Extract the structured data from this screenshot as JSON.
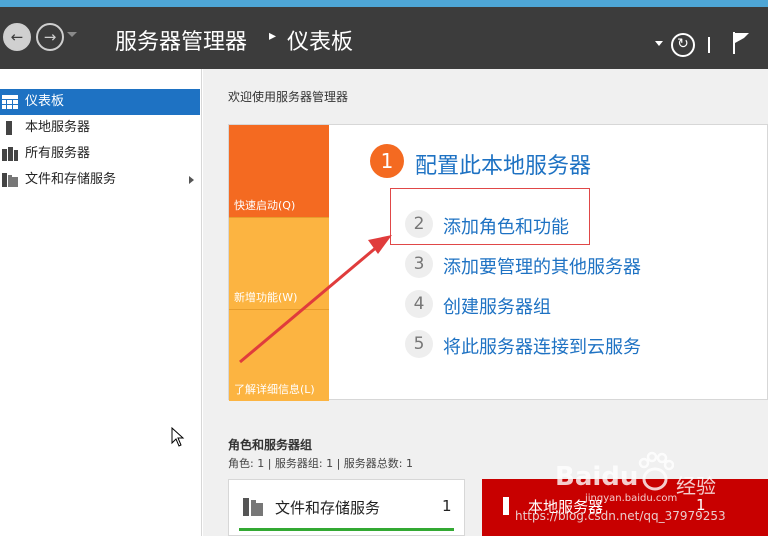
{
  "header": {
    "title": "服务器管理器",
    "separator": "▸",
    "page": "仪表板"
  },
  "sidebar": {
    "items": [
      {
        "label": "仪表板",
        "active": true,
        "icon": "dashboard-icon"
      },
      {
        "label": "本地服务器",
        "active": false,
        "icon": "server-icon"
      },
      {
        "label": "所有服务器",
        "active": false,
        "icon": "servers-icon"
      },
      {
        "label": "文件和存储服务",
        "active": false,
        "icon": "storage-icon"
      }
    ]
  },
  "main": {
    "welcome": "欢迎使用服务器管理器",
    "tiles": [
      {
        "label": "快速启动(Q)",
        "color": "#f46a21"
      },
      {
        "label": "新增功能(W)",
        "color": "#fcb441"
      },
      {
        "label": "了解详细信息(L)",
        "color": "#fcb441"
      }
    ],
    "steps": [
      {
        "num": "1",
        "label": "配置此本地服务器"
      },
      {
        "num": "2",
        "label": "添加角色和功能"
      },
      {
        "num": "3",
        "label": "添加要管理的其他服务器"
      },
      {
        "num": "4",
        "label": "创建服务器组"
      },
      {
        "num": "5",
        "label": "将此服务器连接到云服务"
      }
    ],
    "roles": {
      "title": "角色和服务器组",
      "counts": "角色: 1 | 服务器组: 1 | 服务器总数: 1",
      "cards": [
        {
          "label": "文件和存储服务",
          "count": "1",
          "color": "#ffffff"
        },
        {
          "label": "本地服务器",
          "count": "1",
          "color": "#c80000"
        }
      ]
    }
  },
  "watermark": {
    "logo": "Baidu",
    "cn": "经验",
    "sub": "jingyan.baidu.com",
    "url": "https://blog.csdn.net/qq_37979253"
  }
}
